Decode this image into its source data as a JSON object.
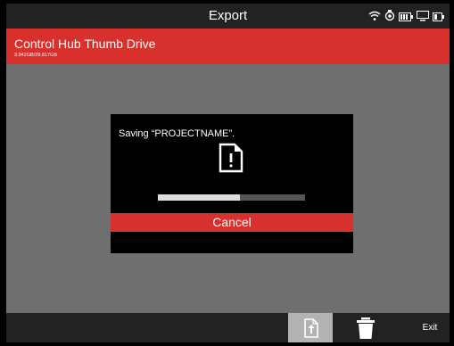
{
  "header": {
    "title": "Export",
    "icons": [
      "wifi-icon",
      "camera-icon",
      "battery-icon",
      "monitor-icon",
      "battery-small-icon"
    ]
  },
  "drive": {
    "name": "Control Hub Thumb Drive",
    "size": "3.942GB/29.817GB"
  },
  "dialog": {
    "message": "Saving “PROJECTNAME”.",
    "progress_fraction": 0.56,
    "cancel_label": "Cancel"
  },
  "footer": {
    "exit_label": "Exit"
  },
  "colors": {
    "accent": "#d8302c",
    "background": "#6f6f6f",
    "bar": "#222222"
  }
}
